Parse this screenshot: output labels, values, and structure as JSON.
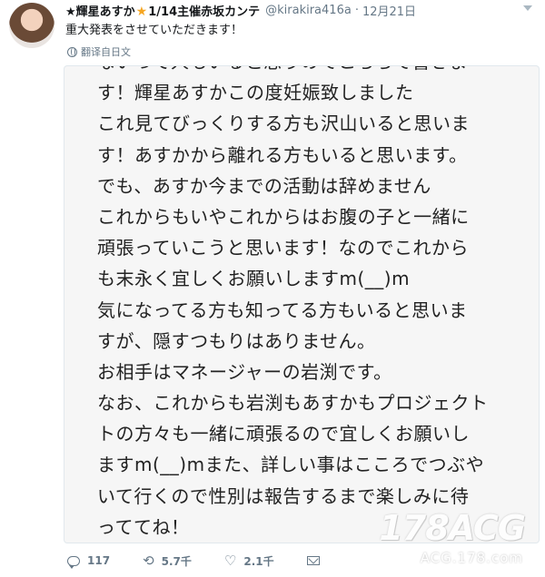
{
  "tweet": {
    "display_name": "輝星あすか",
    "display_name_suffix": "1/14主催赤坂カンテ",
    "handle": "@kirakira416a",
    "separator": "·",
    "date": "12月21日",
    "text": "重大発表をさせていただきます！",
    "translate_label": "翻译自日文"
  },
  "image_text_lines": [
    "ないって人もいると思うのでこちらで書きま",
    "す！輝星あすかこの度妊娠致しました",
    "これ見てびっくりする方も沢山いると思いま",
    "す！あすかから離れる方もいると思います。",
    "でも、あすか今までの活動は辞めません",
    "これからもいやこれからはお腹の子と一緒に",
    "頑張っていこうと思います！なのでこれから",
    "も末永く宜しくお願いしますm(__)m",
    "気になってる方も知ってる方もいると思いま",
    "すが、隠すつもりはありません。",
    "お相手はマネージャーの岩渕です。",
    "なお、これからも岩渕もあすかもプロジェクト",
    "トの方々も一緒に頑張るので宜しくお願いし",
    "ますm(__)mまた、詳しい事はこころでつぶや",
    "いて行くので性別は報告するまで楽しみに待",
    "っててね！"
  ],
  "actions": {
    "reply_count": "117",
    "retweet_count": "5.7千",
    "like_count": "2.1千"
  },
  "watermark": {
    "big": "178ACG",
    "small": "ACG.178.com"
  },
  "colors": {
    "text": "#14171a",
    "secondary": "#657786",
    "star": "#f5a623",
    "card_bg": "#f6f6f6"
  },
  "icons": [
    "avatar",
    "star-icon",
    "caret-down-icon",
    "globe-icon",
    "reply-icon",
    "retweet-icon",
    "heart-icon",
    "dm-icon"
  ]
}
